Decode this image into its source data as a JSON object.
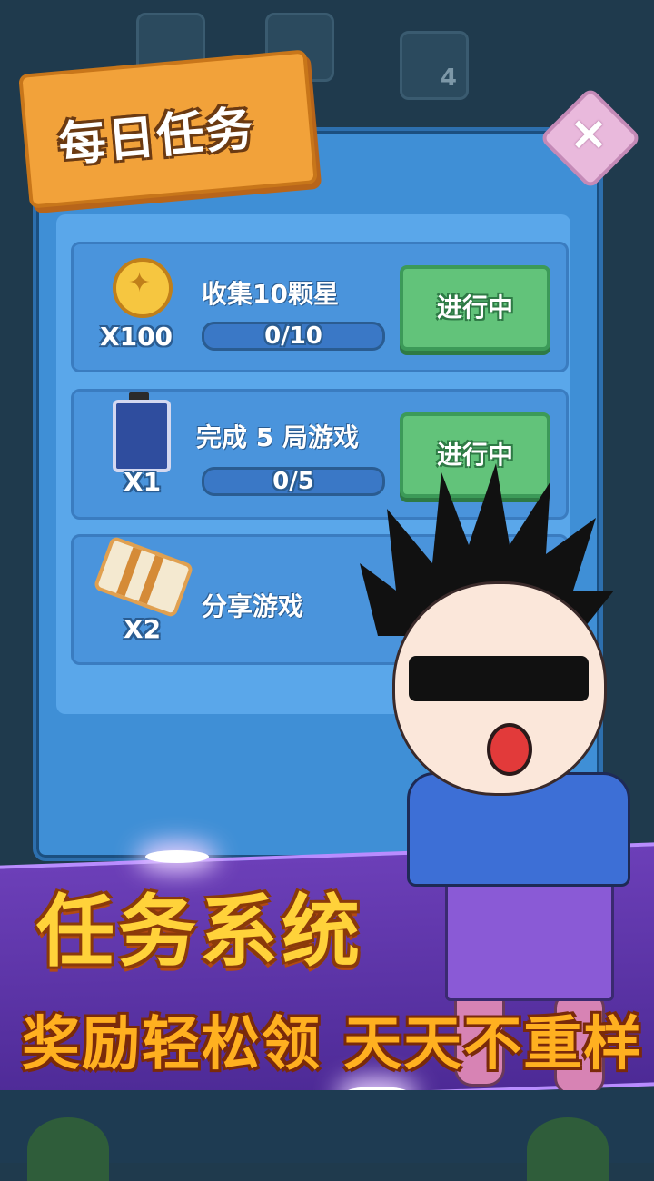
{
  "dialog": {
    "title": "每日任务",
    "close_label": "×"
  },
  "tasks": [
    {
      "icon": "coin-icon",
      "name": "收集10颗星",
      "reward": "X100",
      "progress_text": "0/10",
      "progress_value": 0,
      "status": "进行中"
    },
    {
      "icon": "battery-icon",
      "name": "完成 5 局游戏",
      "reward": "X1",
      "progress_text": "0/5",
      "progress_value": 0,
      "status": "进行中"
    },
    {
      "icon": "ticket-icon",
      "name": "分享游戏",
      "reward": "X2"
    }
  ],
  "background": {
    "level_tile_number": "4"
  },
  "promo": {
    "title": "任务系统",
    "subtitle": "奖励轻松领 天天不重样"
  },
  "colors": {
    "panel": "#3f8fd6",
    "title_banner": "#f2a23a",
    "status_button": "#62c37a",
    "promo_band": "#6c3fb8",
    "promo_title": "#ffd23a"
  }
}
